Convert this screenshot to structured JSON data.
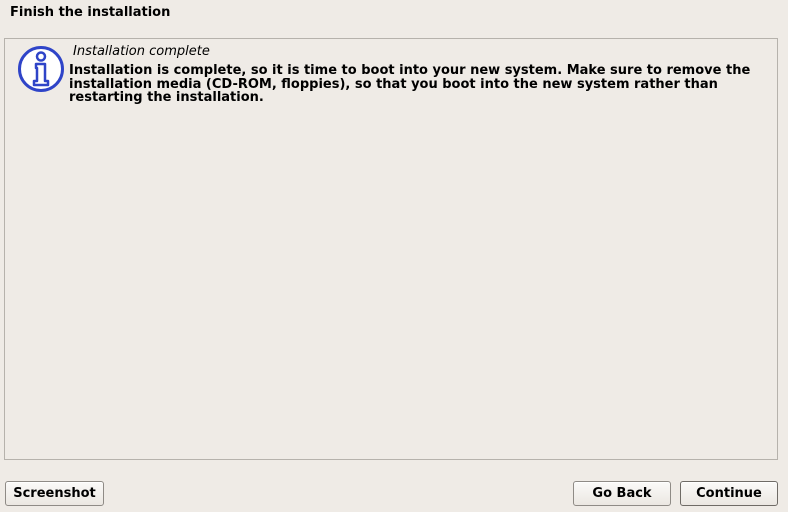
{
  "header": {
    "title": "Finish the installation"
  },
  "dialog": {
    "icon": "info-icon",
    "title": "Installation complete",
    "message": "Installation is complete, so it is time to boot into your new system. Make sure to remove the installation media (CD-ROM, floppies), so that you boot into the new system rather than restarting the installation."
  },
  "buttons": {
    "screenshot": "Screenshot",
    "go_back": "Go Back",
    "continue": "Continue"
  },
  "colors": {
    "background": "#efebe6",
    "panel_border": "#b6b2ac",
    "icon_blue": "#2f44c8"
  }
}
